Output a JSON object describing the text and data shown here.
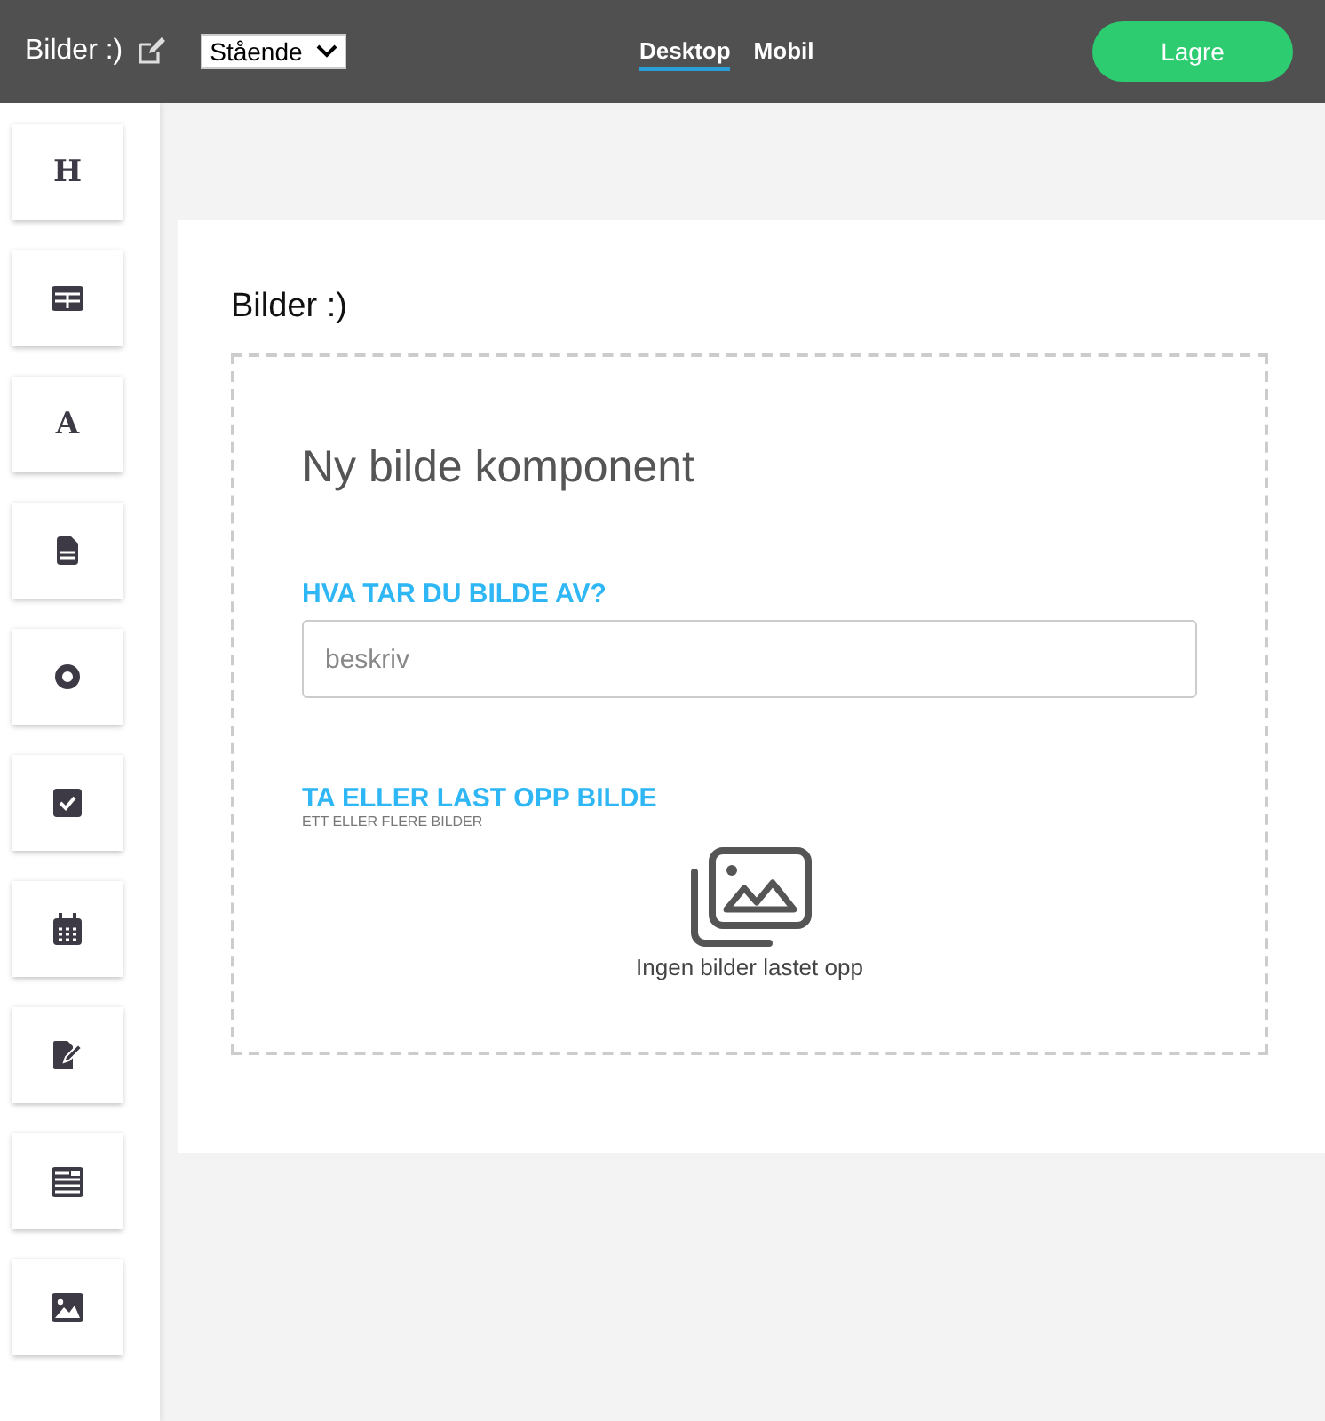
{
  "header": {
    "title": "Bilder :)",
    "orientation_select": "Stående",
    "view_tabs": [
      {
        "label": "Desktop",
        "selected": true
      },
      {
        "label": "Mobil",
        "selected": false
      }
    ],
    "save_button": "Lagre"
  },
  "toolbox": [
    {
      "kind": "glyph",
      "glyph": "H"
    },
    {
      "kind": "table"
    },
    {
      "kind": "glyph",
      "glyph": "A"
    },
    {
      "kind": "document"
    },
    {
      "kind": "radio"
    },
    {
      "kind": "checkbox"
    },
    {
      "kind": "calendar"
    },
    {
      "kind": "signature"
    },
    {
      "kind": "article"
    },
    {
      "kind": "image"
    }
  ],
  "page": {
    "title": "Bilder :)",
    "component": {
      "heading": "Ny bilde komponent",
      "question_label": "HVA TAR DU BILDE AV?",
      "question_placeholder": "beskriv",
      "upload_label": "TA ELLER LAST OPP BILDE",
      "upload_hint": "ETT ELLER FLERE BILDER",
      "empty_text": "Ingen bilder lastet opp"
    }
  }
}
